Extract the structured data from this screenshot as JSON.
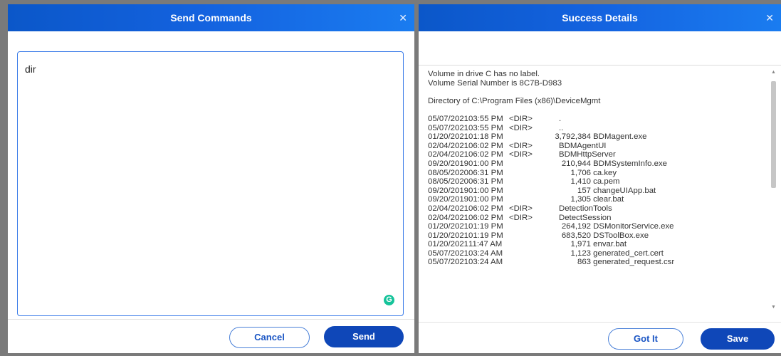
{
  "send_dialog": {
    "title": "Send Commands",
    "close_glyph": "✕",
    "command_text": "dir",
    "grammarly_glyph": "G",
    "cancel_label": "Cancel",
    "send_label": "Send"
  },
  "details_dialog": {
    "title": "Success Details",
    "close_glyph": "✕",
    "header_lines": [
      "Volume in drive C has no label.",
      "Volume Serial Number is 8C7B-D983",
      "",
      "Directory of C:\\Program Files (x86)\\DeviceMgmt",
      ""
    ],
    "entries": [
      {
        "date": "05/07/2021",
        "time": "03:55 PM",
        "tag": "<DIR>",
        "size": "",
        "name": "."
      },
      {
        "date": "05/07/2021",
        "time": "03:55 PM",
        "tag": "<DIR>",
        "size": "",
        "name": ".."
      },
      {
        "date": "01/20/2021",
        "time": "01:18 PM",
        "tag": "",
        "size": "3,792,384",
        "name": "BDMagent.exe"
      },
      {
        "date": "02/04/2021",
        "time": "06:02 PM",
        "tag": "<DIR>",
        "size": "",
        "name": "BDMAgentUI"
      },
      {
        "date": "02/04/2021",
        "time": "06:02 PM",
        "tag": "<DIR>",
        "size": "",
        "name": "BDMHttpServer"
      },
      {
        "date": "09/20/2019",
        "time": "01:00 PM",
        "tag": "",
        "size": "210,944",
        "name": "BDMSystemInfo.exe"
      },
      {
        "date": "08/05/2020",
        "time": "06:31 PM",
        "tag": "",
        "size": "1,706",
        "name": "ca.key"
      },
      {
        "date": "08/05/2020",
        "time": "06:31 PM",
        "tag": "",
        "size": "1,410",
        "name": "ca.pem"
      },
      {
        "date": "09/20/2019",
        "time": "01:00 PM",
        "tag": "",
        "size": "157",
        "name": "changeUIApp.bat"
      },
      {
        "date": "09/20/2019",
        "time": "01:00 PM",
        "tag": "",
        "size": "1,305",
        "name": "clear.bat"
      },
      {
        "date": "02/04/2021",
        "time": "06:02 PM",
        "tag": "<DIR>",
        "size": "",
        "name": "DetectionTools"
      },
      {
        "date": "02/04/2021",
        "time": "06:02 PM",
        "tag": "<DIR>",
        "size": "",
        "name": "DetectSession"
      },
      {
        "date": "01/20/2021",
        "time": "01:19 PM",
        "tag": "",
        "size": "264,192",
        "name": "DSMonitorService.exe"
      },
      {
        "date": "01/20/2021",
        "time": "01:19 PM",
        "tag": "",
        "size": "683,520",
        "name": "DSToolBox.exe"
      },
      {
        "date": "01/20/2021",
        "time": "11:47 AM",
        "tag": "",
        "size": "1,971",
        "name": "envar.bat"
      },
      {
        "date": "05/07/2021",
        "time": "03:24 AM",
        "tag": "",
        "size": "1,123",
        "name": "generated_cert.cert"
      },
      {
        "date": "05/07/2021",
        "time": "03:24 AM",
        "tag": "",
        "size": "863",
        "name": "generated_request.csr"
      }
    ],
    "gotit_label": "Got It",
    "save_label": "Save"
  },
  "colors": {
    "title_gradient_start": "#0b57c9",
    "title_gradient_end": "#1a7cf0",
    "primary_button": "#0f47b8",
    "input_border": "#3a7be8",
    "backdrop": "#7a7a7a"
  },
  "icons": {
    "close": "close-icon",
    "grammarly": "grammarly-icon",
    "scroll_up": "scroll-up-icon",
    "scroll_down": "scroll-down-icon"
  }
}
